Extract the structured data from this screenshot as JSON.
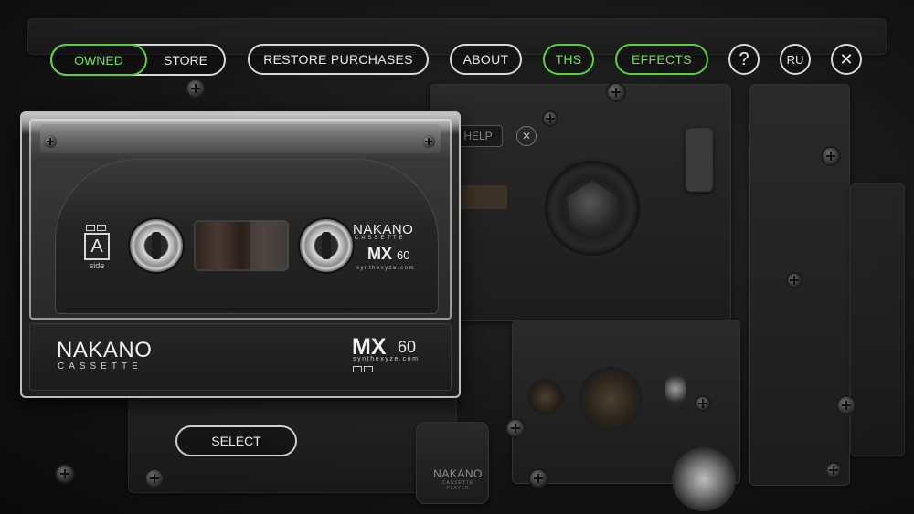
{
  "tabs": {
    "owned": "OWNED",
    "store": "STORE"
  },
  "buttons": {
    "restore": "RESTORE PURCHASES",
    "about": "ABOUT",
    "ths": "THS",
    "effects": "EFFECTS",
    "help_icon": "?",
    "lang": "RU",
    "close_icon": "✕",
    "select": "SELECT"
  },
  "help_overlay": {
    "label": "HELP",
    "close": "✕"
  },
  "cassette": {
    "side_letter": "A",
    "side_label": "side",
    "brand": "NAKANO",
    "brand_sub": "CASSETTE",
    "model": "MX",
    "model_num": "60",
    "url": "synthexyze.com"
  },
  "deck": {
    "brand": "NAKANO",
    "sub": "CASSETTE PLAYER"
  },
  "colors": {
    "accent_green": "#59d13a",
    "pill_border": "#d9d9d9",
    "background": "#0b0b0b"
  },
  "icons": {
    "help": "question-icon",
    "close": "close-icon"
  }
}
